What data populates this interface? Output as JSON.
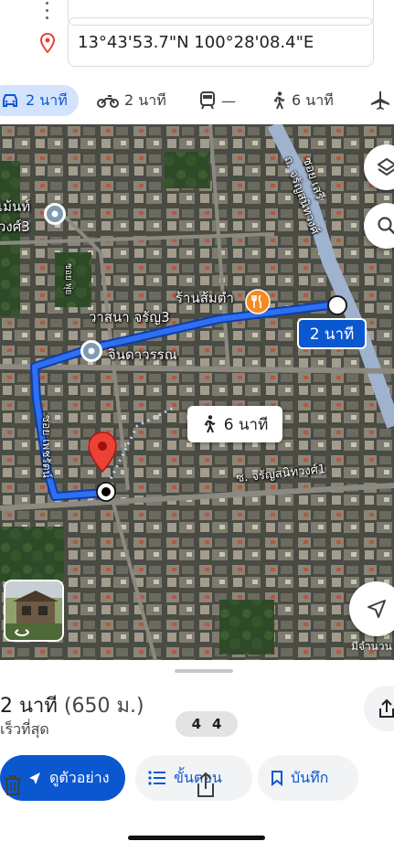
{
  "search": {
    "destination": "13°43'53.7\"N 100°28'08.4\"E"
  },
  "modes": {
    "drive": {
      "label": "2 นาที",
      "icon": "car-icon"
    },
    "motorbike": {
      "label": "2 นาที",
      "icon": "motorbike-icon"
    },
    "transit": {
      "label": "—",
      "icon": "train-icon"
    },
    "walk": {
      "label": "6 นาที",
      "icon": "walk-icon"
    },
    "flight": {
      "icon": "plane-icon"
    }
  },
  "map": {
    "labels": {
      "l1": "เม้นท์",
      "l2": "วงศ์3",
      "l3": "ร้านส้มตำ",
      "l4": "วาสนา จรัญ3",
      "l5": "จินดาวรรณ",
      "l6": "ซอย เสรี",
      "l7": "ถ. จรัญสนิทวงศ์",
      "l8": "ซ. จรัญสนิทวงศ์1",
      "l9": "ซอย เพชรัตน์",
      "l10": "ซอย พุ่ย"
    },
    "drive_callout": "2 นาที",
    "walk_callout": "6 นาที",
    "watermark": "มีจำนวน",
    "route_color": "#1a5fd6",
    "pin_color": "#ea4335"
  },
  "summary": {
    "duration": "2 นาที",
    "distance": "(650 ม.)",
    "subtitle": "เร็วที่สุด",
    "pager_current": "4",
    "pager_total": "4"
  },
  "actions": {
    "preview": "ดูตัวอย่าง",
    "steps": "ขั้นตอน",
    "save": "บันทึก"
  }
}
